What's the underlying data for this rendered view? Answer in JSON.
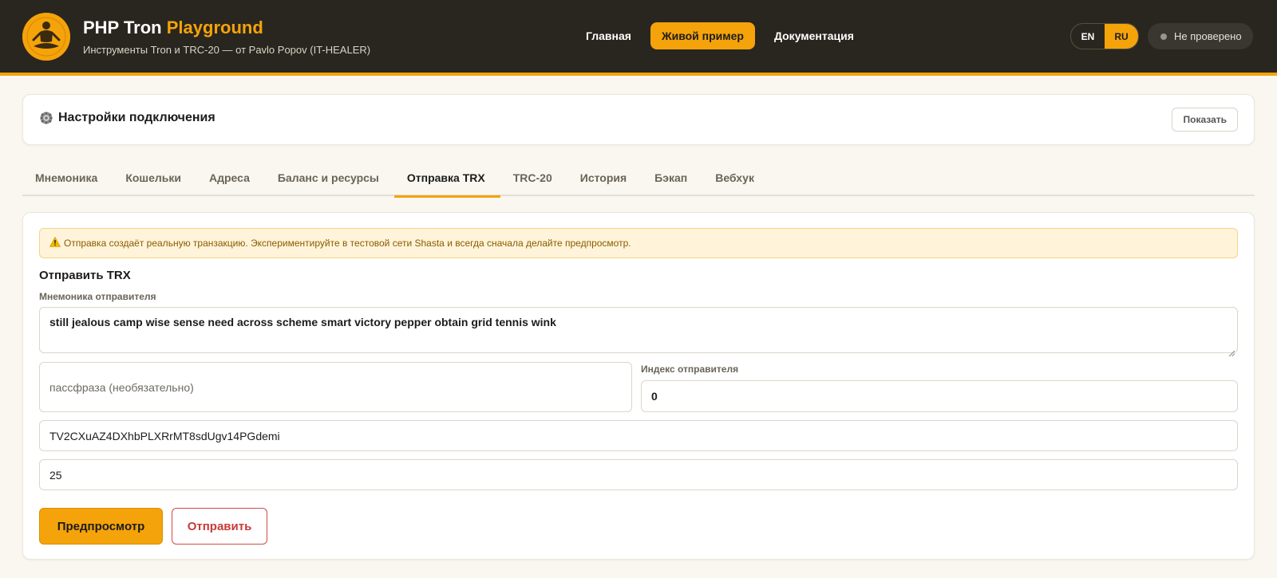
{
  "header": {
    "title_main": "PHP Tron",
    "title_accent": "Playground",
    "subtitle": "Инструменты Tron и TRC-20 — от Pavlo Popov (IT-HEALER)",
    "nav": [
      {
        "label": "Главная"
      },
      {
        "label": "Живой пример",
        "active": true
      },
      {
        "label": "Документация"
      }
    ],
    "languages": [
      {
        "label": "EN"
      },
      {
        "label": "RU",
        "active": true
      }
    ],
    "status": "Не проверено"
  },
  "settings": {
    "title": "Настройки подключения",
    "toggle_label": "Показать"
  },
  "tabs": [
    {
      "label": "Мнемоника"
    },
    {
      "label": "Кошельки"
    },
    {
      "label": "Адреса"
    },
    {
      "label": "Баланс и ресурсы"
    },
    {
      "label": "Отправка TRX",
      "active": true
    },
    {
      "label": "TRC-20"
    },
    {
      "label": "История"
    },
    {
      "label": "Бэкап"
    },
    {
      "label": "Вебхук"
    }
  ],
  "send": {
    "warning": "Отправка создаёт реальную транзакцию. Экспериментируйте в тестовой сети Shasta и всегда сначала делайте предпросмотр.",
    "title": "Отправить TRX",
    "mnemonic_label": "Мнемоника отправителя",
    "mnemonic_value": "still jealous camp wise sense need across scheme smart victory pepper obtain grid tennis wink",
    "passphrase_placeholder": "пассфраза (необязательно)",
    "index_label": "Индекс отправителя",
    "index_value": "0",
    "to_address_value": "TV2CXuAZ4DXhbPLXRrMT8sdUgv14PGdemi",
    "amount_value": "25",
    "preview_label": "Предпросмотр",
    "send_label": "Отправить"
  },
  "colors": {
    "accent": "#f5a30a",
    "header_bg": "#29261f",
    "danger": "#c83a3a",
    "warning_bg": "#fff4d9"
  },
  "icons": {
    "logo": "meditating-figure-logo",
    "settings": "gear-icon",
    "warning": "warning-icon",
    "status": "status-dot-icon"
  }
}
